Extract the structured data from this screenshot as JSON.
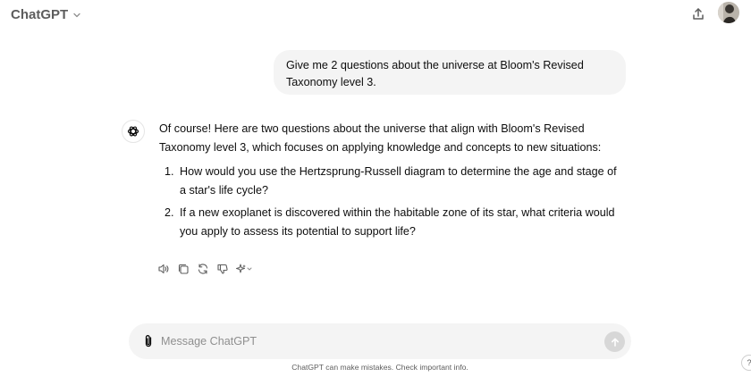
{
  "header": {
    "model_name": "ChatGPT",
    "model_icon": "chevron-down-icon",
    "share_icon": "share-icon",
    "avatar_icon": "user-avatar"
  },
  "conversation": {
    "user_message": "Give me 2 questions about the universe at Bloom's Revised Taxonomy level 3.",
    "assistant": {
      "logo_icon": "openai-logo-icon",
      "intro": "Of course! Here are two questions about the universe that align with Bloom's Revised Taxonomy level 3, which focuses on applying knowledge and concepts to new situations:",
      "questions": [
        {
          "number": "1.",
          "text": "How would you use the Hertzsprung-Russell diagram to determine the age and stage of a star's life cycle?"
        },
        {
          "number": "2.",
          "text": "If a new exoplanet is discovered within the habitable zone of its star, what criteria would you apply to assess its potential to support life?"
        }
      ]
    },
    "actions": [
      "read-aloud-icon",
      "copy-icon",
      "regenerate-icon",
      "thumbs-down-icon",
      "change-model-icon"
    ]
  },
  "composer": {
    "placeholder": "Message ChatGPT",
    "attach_icon": "paperclip-icon",
    "send_icon": "arrow-up-icon"
  },
  "footer": {
    "disclaimer": "ChatGPT can make mistakes. Check important info.",
    "help_label": "?"
  },
  "colors": {
    "bubble_bg": "#f4f4f4",
    "text": "#0d0d0d",
    "muted": "#5d5d5d",
    "send_disabled": "#d7d7d7"
  }
}
